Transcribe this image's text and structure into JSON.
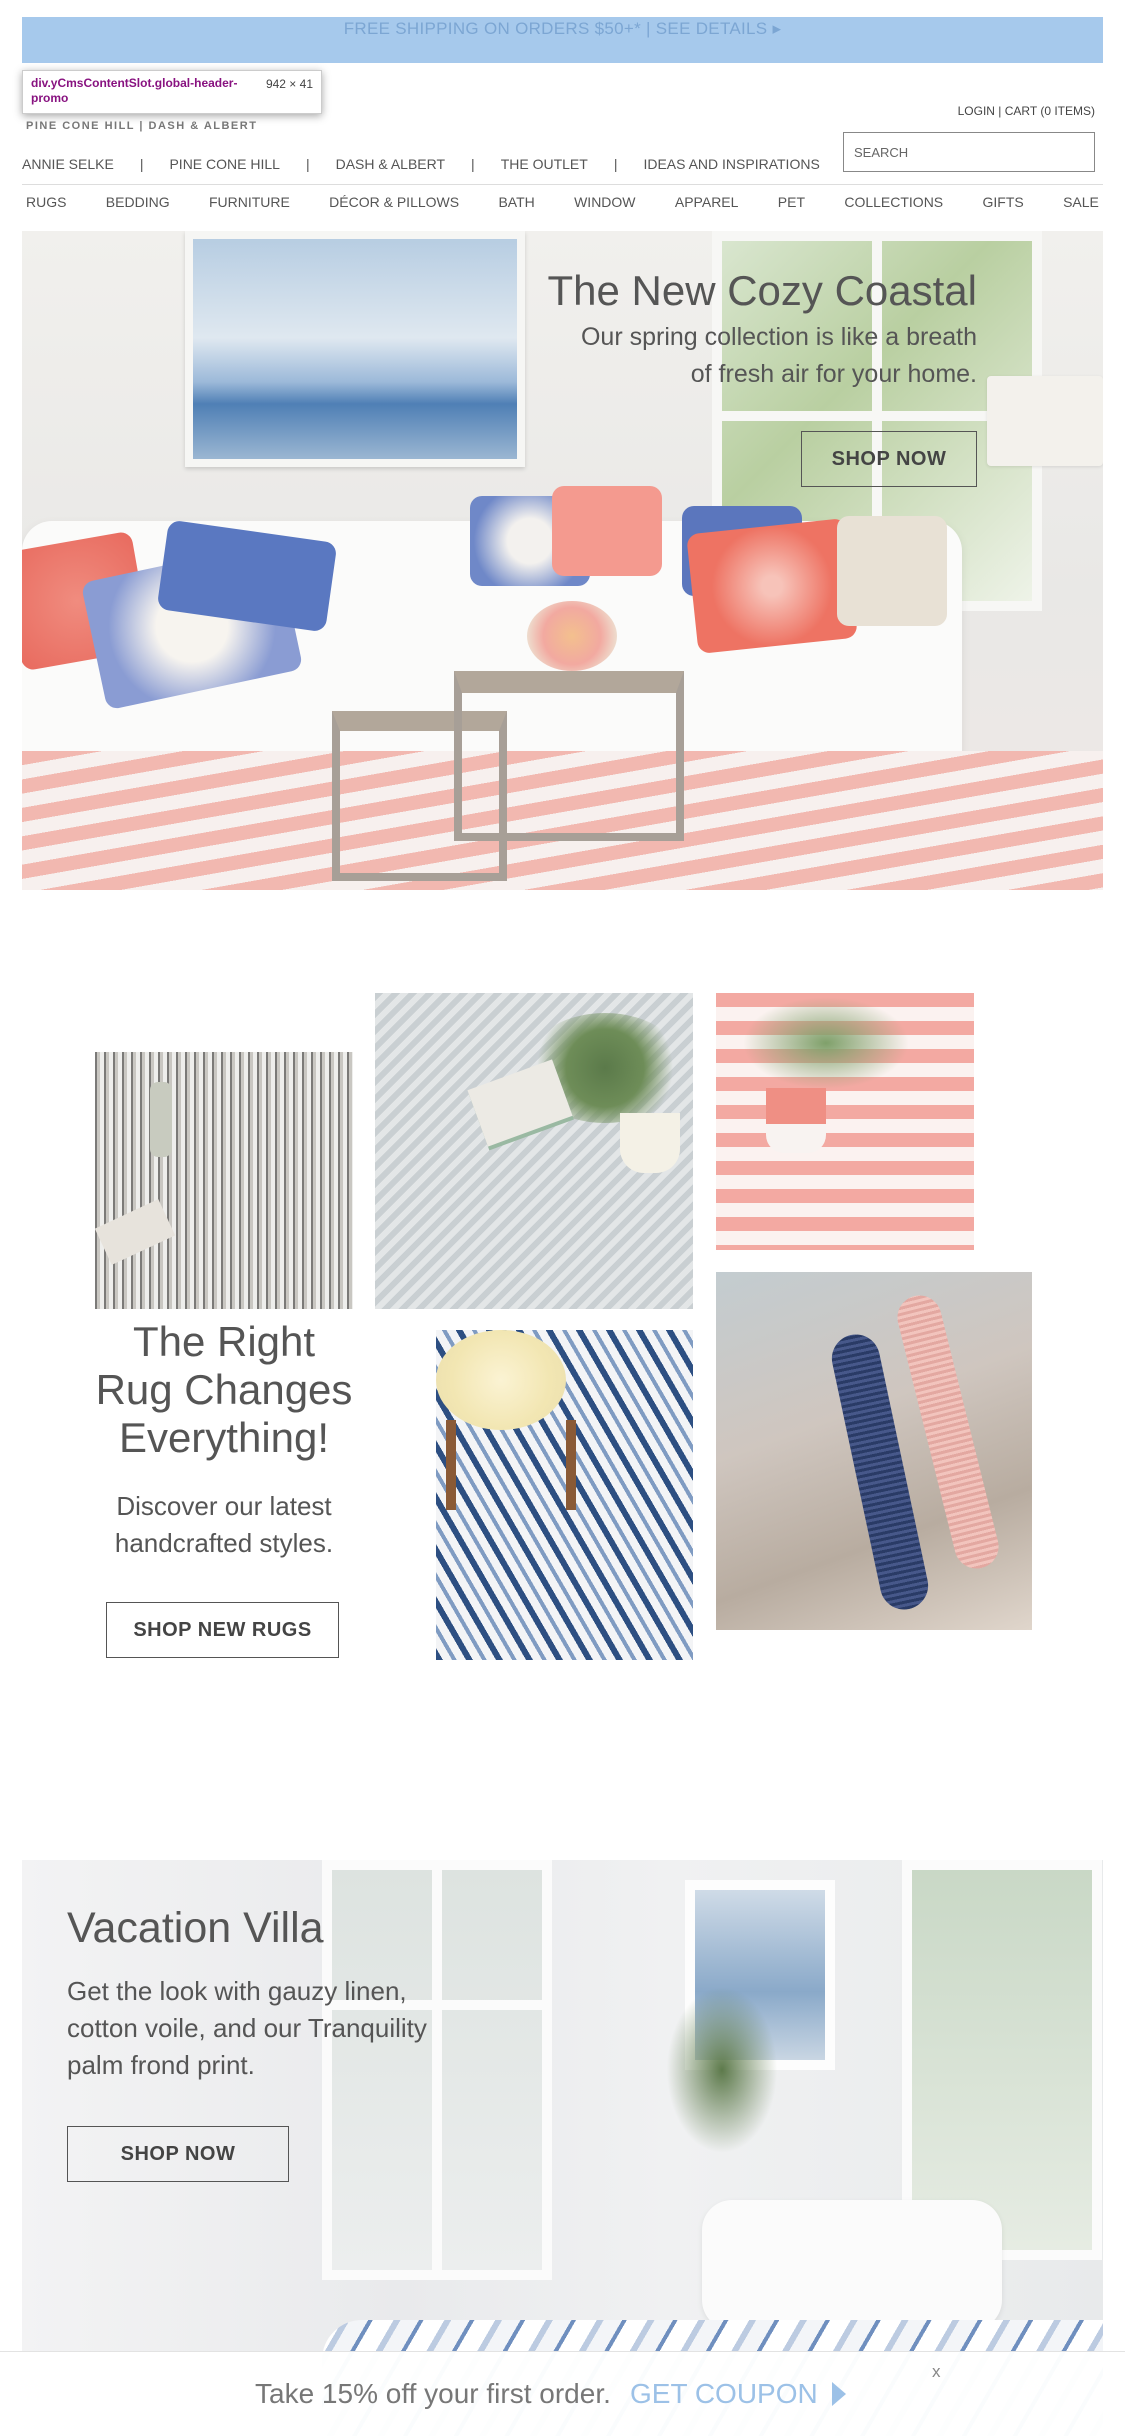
{
  "promo": {
    "text": "FREE SHIPPING ON ORDERS $50+* | SEE DETAILS ▸"
  },
  "devtools_tooltip": {
    "selector": "div.yCmsContentSlot.global-header-promo",
    "size": "942 × 41"
  },
  "header": {
    "brand_line": "PINE CONE HILL  |  DASH & ALBERT",
    "login": "LOGIN",
    "account_sep": "|",
    "cart": "CART (0 ITEMS)",
    "search_placeholder": "SEARCH"
  },
  "brands": [
    "ANNIE SELKE",
    "PINE CONE HILL",
    "DASH & ALBERT",
    "THE OUTLET",
    "IDEAS AND INSPIRATIONS"
  ],
  "brand_separator": "|",
  "categories": [
    "RUGS",
    "BEDDING",
    "FURNITURE",
    "DÉCOR & PILLOWS",
    "BATH",
    "WINDOW",
    "APPAREL",
    "PET",
    "COLLECTIONS",
    "GIFTS",
    "SALE"
  ],
  "hero": {
    "title": "The New Cozy Coastal",
    "subtitle": "Our spring collection is like a breath of fresh air for your home.",
    "button": "SHOP NOW"
  },
  "rugs": {
    "title": "The Right Rug Changes Everything!",
    "subtitle": "Discover our latest handcrafted styles.",
    "button": "SHOP NEW RUGS"
  },
  "villa": {
    "title": "Vacation Villa",
    "subtitle": "Get the look with gauzy linen, cotton voile, and our Tranquility palm frond print.",
    "button": "SHOP NOW"
  },
  "coupon": {
    "text": "Take 15% off your first order.",
    "link": "GET COUPON",
    "close": "x"
  },
  "colors": {
    "promo_bg": "#a6c9ec",
    "promo_text": "#7ca6d3",
    "coupon_link": "#9cc1e7",
    "text": "#555555"
  }
}
